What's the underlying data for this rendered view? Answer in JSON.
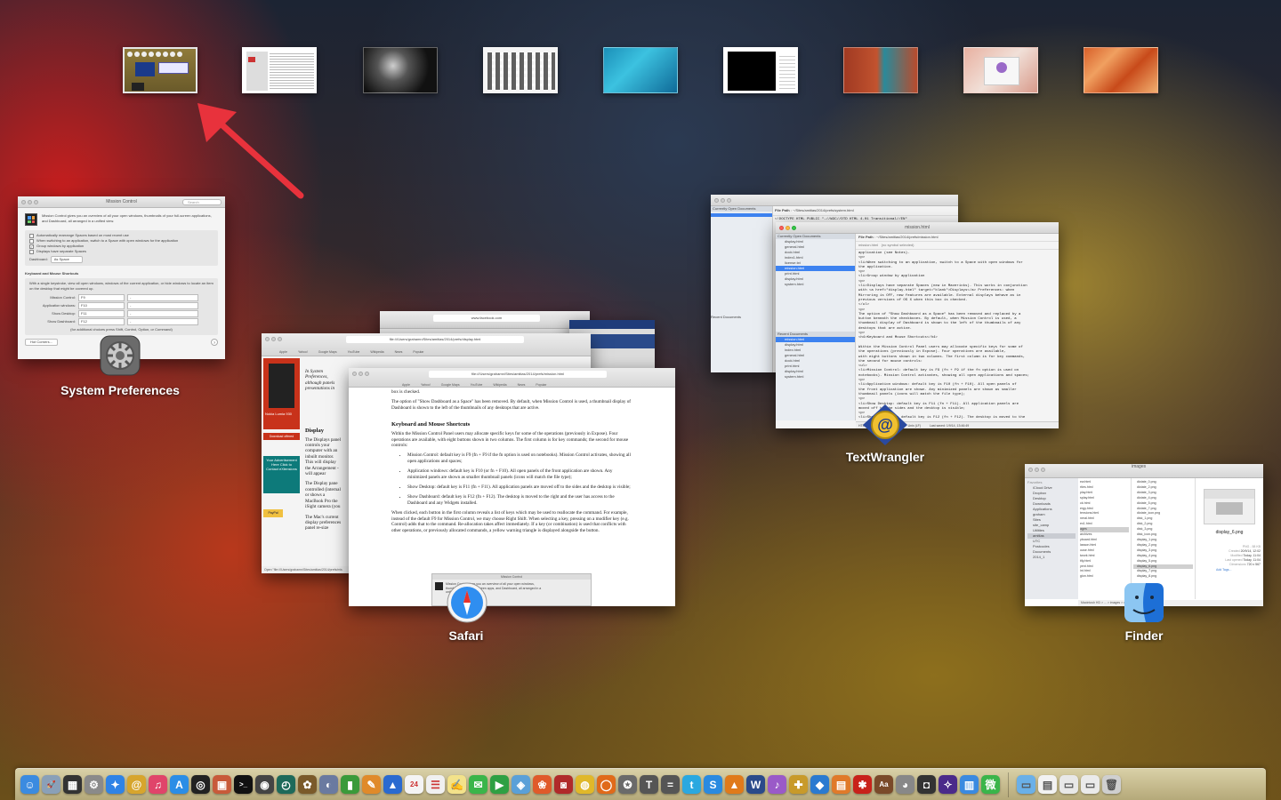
{
  "spaces": [
    {
      "id": "dashboard",
      "active": true
    },
    {
      "id": "desktop-2"
    },
    {
      "id": "desktop-3"
    },
    {
      "id": "desktop-4"
    },
    {
      "id": "desktop-5"
    },
    {
      "id": "desktop-6"
    },
    {
      "id": "desktop-7"
    },
    {
      "id": "desktop-8"
    },
    {
      "id": "desktop-9"
    }
  ],
  "colors": {
    "arrow": "#e8323c",
    "selection": "#3d82f0"
  },
  "apps": {
    "system_preferences": {
      "label": "System Preferences",
      "window_title": "Mission Control",
      "search_placeholder": "Search",
      "intro": "Mission Control gives you an overview of all your open windows, thumbnails of your full-screen applications, and Dashboard, all arranged in a unified view.",
      "checkboxes": [
        {
          "label": "Automatically rearrange Spaces based on most recent use",
          "checked": false
        },
        {
          "label": "When switching to an application, switch to a Space with open windows for the application",
          "checked": false
        },
        {
          "label": "Group windows by application",
          "checked": true
        },
        {
          "label": "Displays have separate Spaces",
          "checked": false
        }
      ],
      "dashboard_label": "Dashboard:",
      "dashboard_value": "As Space",
      "shortcuts_heading": "Keyboard and Mouse Shortcuts",
      "shortcuts_desc": "With a single keystroke, view all open windows, windows of the current application, or hide windows to locate an item on the desktop that might be covered up.",
      "shortcuts": [
        {
          "label": "Mission Control:",
          "key": "F9",
          "mouse": "-"
        },
        {
          "label": "Application windows:",
          "key": "F10",
          "mouse": "-"
        },
        {
          "label": "Show Desktop:",
          "key": "F11",
          "mouse": "-"
        },
        {
          "label": "Show Dashboard:",
          "key": "F12",
          "mouse": "-"
        }
      ],
      "footnote": "(for additional choices press Shift, Control, Option, or Command)",
      "hot_corners": "Hot Corners...",
      "help": "?"
    },
    "safari": {
      "label": "Safari",
      "url_front": "file:///Users/grahamn/Sites/amitias/2014/prefs/mission.html",
      "url_back": "file:///Users/grahamn/Sites/amitias/2014/prefs/display.html",
      "url_fb": "www.facebook.com",
      "bookmarks": [
        "Apple",
        "Yahoo!",
        "Google Maps",
        "YouTube",
        "Wikipedia",
        "News",
        "Popular"
      ],
      "back_doc": {
        "intro": "In System Preferences, although panels presentations in",
        "heading": "Display",
        "para1": "The Displays panel controls your computer with an inbuilt monitor. This will display the Arrangement - will appear",
        "para2": "The Display pane controlled (internal or shows a MacBook Pro the iSight camera (you",
        "para3": "The Mac's current display preferences panel re-size",
        "ad_title": "Nokia Lumia 930",
        "ad_btn": "Download offered",
        "ad_box": "Your Advertisement Here Click to Contact eXtensions",
        "paypal": "PayPal",
        "status": "Open \"file:///Users/grahamn/Sites/amitias/2014/prefs/mis"
      },
      "front_doc": {
        "lead": "box is checked.",
        "p1": "The option of \"Show Dashboard as a Space\" has been removed. By default, when Mission Control is used, a thumbnail display of Dashboard is shown to the left of the thumbnails of any desktops that are active.",
        "h": "Keyboard and Mouse Shortcuts",
        "p2": "Within the Mission Control Panel users may allocate specific keys for some of the operations (previously in Expose). Four operations are available, with eight buttons shown in two columns. The first column is for key commands; the second for mouse controls:",
        "items": [
          "Mission Control: default key is F9 (fn + F9 if the fn option is used on notebooks). Mission Control activates, showing all open applications and spaces;",
          "Application windows: default key is F10 (or fn + F10). All open panels of the front application are shown. Any minimized panels are shown as smaller thumbnail panels (icons will match the file type);",
          "Show Desktop: default key is F11 (fn + F11). All application panels are moved off to the sides and the desktop is visible;",
          "Show Dashboard: default key is F12 (fn + F12). The desktop is moved to the right and the user has access to the Dashboard and any Widgets installed."
        ],
        "p3": "When clicked, each button in the first column reveals a list of keys which may be used to reallocate the command. For example, instead of the default F9 for Mission Control, we may choose Right Shift. When selecting a key, pressing on a modifier key (e.g. Control) adds that to the command. Re-allocation takes affect immediately. If a key (or combination) is used that conflicts with other operations, or previously allocated commands, a yellow warning triangle is displayed alongside the button.",
        "popup_title": "Mission Control",
        "popup_search": "Search",
        "popup_text": "Mission Control gives you an overview of all your open windows, thumbnails of your full-screen apps, and Dashboard, all arranged in a unified view."
      }
    },
    "textwrangler": {
      "label": "TextWrangler",
      "sidebar_heading": "Currently Open Documents",
      "recent_heading": "Recent Documents",
      "file_path_label": "File Path",
      "file_path": "~/Sites/amitias/2014/prefs/mission.html",
      "file_path_back": "~/Sites/amitias/2014/prefs/system.html",
      "tab_title": "mission.html",
      "no_symbol": "(no symbol selected)",
      "docs": [
        "display.html",
        "general.html",
        "dock.html",
        "index1.html",
        "license.txt",
        "mission.html",
        "print.html",
        "display.html",
        "system.html"
      ],
      "recent_docs": [
        "mission.html",
        "display.html",
        "index.html",
        "general.html",
        "dock.html",
        "print.html",
        "display.html",
        "system.html"
      ],
      "code": "application (see Notes).\n<p>\n<li>When switching to an application, switch to a Space with open windows for\nthe application.\n<p>\n<li>Group window by application\n<p>\n<li>Displays have separate Spaces (new in Mavericks). This works in conjunction\nwith <a href=\"display.html\" target=\"blank\">Displays</a> Preferences: when\nMirroring is OFF, new features are available. External displays behave as in\nprevious versions of OS X when this box is checked.\n</ul>\n<p>\nThe option of \"Show Dashboard as a Space\" has been removed and replaced by a\nbutton beneath the checkboxes. By default, when Mission Control is used, a\nthumbnail display of Dashboard is shown to the left of the thumbnails of any\ndesktops that are active.\n<p>\n<h4>Keyboard and Mouse Shortcuts</h4>\n\nWithin the Mission Control Panel users may allocate specific keys for some of\nthe operations (previously in Expose). Four operations are available,\nwith eight buttons shown in two columns. The first column is for key commands,\nthe second for mouse controls:\n<ul>\n<li>Mission Control: default key is F9 (fn + F9 if the fn option is used on\nnotebooks). Mission Control activates, showing all open applications and spaces;\n<p>\n<li>Application windows: default key is F10 (fn + F10). All open panels of\nthe front application are shown. Any minimized panels are shown as smaller\nthumbnail panels (icons will match the file type);\n<p>\n<li>Show Desktop: default key is F11 (fn + F11). All application panels are\nmoved off to the sides and the desktop is visible;\n<p>\n<li>Show Dashboard: default key is F12 (fn + F12). The desktop is moved to the",
      "status_items": [
        "HTML",
        "Unicode (UTF-8)",
        "Unix (LF)",
        "Last saved: 1/9/14, 13:46:49"
      ]
    },
    "finder": {
      "label": "Finder",
      "window_title": "images",
      "sidebar_favorites": "Favorites",
      "sidebar": [
        "iCloud Drive",
        "Dropbox",
        "Desktop",
        "Downloads",
        "Applications",
        "graham",
        "Sites",
        "site_camp",
        "Utilities",
        "amitias",
        "UTC",
        "Postcodes",
        "Documents",
        "2014_1"
      ],
      "column1": [
        "ew.html",
        "rties.html",
        "play.html",
        "splay.html",
        "ck.html",
        "ergy.html",
        "tensions.html",
        "neral.html",
        "ex1.html",
        "ages",
        "archives",
        "yboard.html",
        "lasson.html",
        "ouse.html",
        "twork.html",
        "tify.html",
        "yent.html",
        "int.html",
        "gion.html"
      ],
      "column2": [
        "dictate_0.png",
        "dictate_2.png",
        "dictate_3.png",
        "dictate_4.png",
        "dictate_5.png",
        "dictate_7.png",
        "dictate_icon.png",
        "disk_1.png",
        "disk_2.png",
        "disk_3.png",
        "disk_icon.png",
        "display_1.png",
        "display_2.png",
        "display_3.png",
        "display_4.png",
        "display_5.png",
        "display_6.png",
        "display_7.png",
        "display_8.png"
      ],
      "selected_file": "display_6.png",
      "preview_kind": "PNG - 58 KB",
      "info": [
        {
          "k": "Created",
          "v": "20/9/14, 12:02"
        },
        {
          "k": "Modified",
          "v": "Today, 11:04"
        },
        {
          "k": "Last opened",
          "v": "Today, 11:04"
        },
        {
          "k": "Dimensions",
          "v": "720 x 567"
        }
      ],
      "add_tags": "Add Tags...",
      "path_bar": "Macintosh HD > ... > images > display_6.png"
    }
  },
  "dock": [
    {
      "name": "finder",
      "glyph": "☺",
      "bg": "#3b8be0"
    },
    {
      "name": "launchpad",
      "glyph": "🚀",
      "bg": "#8aa0b8"
    },
    {
      "name": "mission-control",
      "glyph": "▦",
      "bg": "#333"
    },
    {
      "name": "system-preferences",
      "glyph": "⚙",
      "bg": "#8a8a8a"
    },
    {
      "name": "safari",
      "glyph": "✦",
      "bg": "#2f83e6"
    },
    {
      "name": "textwrangler",
      "glyph": "@",
      "bg": "#d7a52d"
    },
    {
      "name": "itunes",
      "glyph": "♫",
      "bg": "#e0446a"
    },
    {
      "name": "app-store",
      "glyph": "A",
      "bg": "#2a8de6"
    },
    {
      "name": "aperture",
      "glyph": "◎",
      "bg": "#222"
    },
    {
      "name": "preview",
      "glyph": "▣",
      "bg": "#c85a3a"
    },
    {
      "name": "terminal",
      "glyph": ">_",
      "bg": "#111"
    },
    {
      "name": "activity-monitor",
      "glyph": "◉",
      "bg": "#444"
    },
    {
      "name": "time-machine",
      "glyph": "◴",
      "bg": "#1e6a5a"
    },
    {
      "name": "growl",
      "glyph": "✿",
      "bg": "#7a5a2a"
    },
    {
      "name": "disk-utility",
      "glyph": "◐",
      "bg": "#6a7aa0"
    },
    {
      "name": "numbers",
      "glyph": "▮",
      "bg": "#3a9a3a"
    },
    {
      "name": "pages",
      "glyph": "✎",
      "bg": "#e08a2a"
    },
    {
      "name": "keynote",
      "glyph": "▲",
      "bg": "#2a6ad0"
    },
    {
      "name": "calendar",
      "glyph": "24",
      "bg": "#f4f4f4"
    },
    {
      "name": "reminders",
      "glyph": "☰",
      "bg": "#f0f0f0"
    },
    {
      "name": "notes",
      "glyph": "✍",
      "bg": "#f3e28a"
    },
    {
      "name": "messages",
      "glyph": "✉",
      "bg": "#3ab54a"
    },
    {
      "name": "facetime",
      "glyph": "▶",
      "bg": "#2ea043"
    },
    {
      "name": "maps",
      "glyph": "◈",
      "bg": "#5aa0d8"
    },
    {
      "name": "photos",
      "glyph": "❀",
      "bg": "#e05a2a"
    },
    {
      "name": "photo-booth",
      "glyph": "◙",
      "bg": "#b02a2a"
    },
    {
      "name": "chrome",
      "glyph": "◍",
      "bg": "#e0b82a"
    },
    {
      "name": "firefox",
      "glyph": "◯",
      "bg": "#e06a1a"
    },
    {
      "name": "automator",
      "glyph": "✪",
      "bg": "#6a6a6a"
    },
    {
      "name": "font-book",
      "glyph": "T",
      "bg": "#555"
    },
    {
      "name": "calculator",
      "glyph": "=",
      "bg": "#555"
    },
    {
      "name": "twitter",
      "glyph": "t",
      "bg": "#2aa8e0"
    },
    {
      "name": "skype",
      "glyph": "S",
      "bg": "#2a8ae0"
    },
    {
      "name": "vlc",
      "glyph": "▲",
      "bg": "#e07a1a"
    },
    {
      "name": "word",
      "glyph": "W",
      "bg": "#2a4a8a"
    },
    {
      "name": "itunes-alt",
      "glyph": "♪",
      "bg": "#9a5ac8"
    },
    {
      "name": "bbedit",
      "glyph": "✚",
      "bg": "#c89a2a"
    },
    {
      "name": "sketch",
      "glyph": "◆",
      "bg": "#2a7ad0"
    },
    {
      "name": "ibooks",
      "glyph": "▤",
      "bg": "#e07a2a"
    },
    {
      "name": "acrobat",
      "glyph": "✱",
      "bg": "#c8221a"
    },
    {
      "name": "dictionary",
      "glyph": "Aa",
      "bg": "#7a4a2a"
    },
    {
      "name": "game-center",
      "glyph": "◕",
      "bg": "#888"
    },
    {
      "name": "scanner",
      "glyph": "◘",
      "bg": "#333"
    },
    {
      "name": "iphoto",
      "glyph": "✧",
      "bg": "#4a2a8a"
    },
    {
      "name": "spreadsheet",
      "glyph": "▥",
      "bg": "#3a8ae0"
    },
    {
      "name": "wechat",
      "glyph": "微",
      "bg": "#3ab54a"
    }
  ],
  "dock_right": [
    {
      "name": "applications-folder",
      "glyph": "▭",
      "bg": "#6ab0e8"
    },
    {
      "name": "documents-folder",
      "glyph": "▤",
      "bg": "#f2f2f2"
    },
    {
      "name": "downloads-stack",
      "glyph": "▭",
      "bg": "#e8e8e8"
    },
    {
      "name": "stack",
      "glyph": "▭",
      "bg": "#eaeaea"
    },
    {
      "name": "trash",
      "glyph": "🗑",
      "bg": "#cfcfcf"
    }
  ]
}
